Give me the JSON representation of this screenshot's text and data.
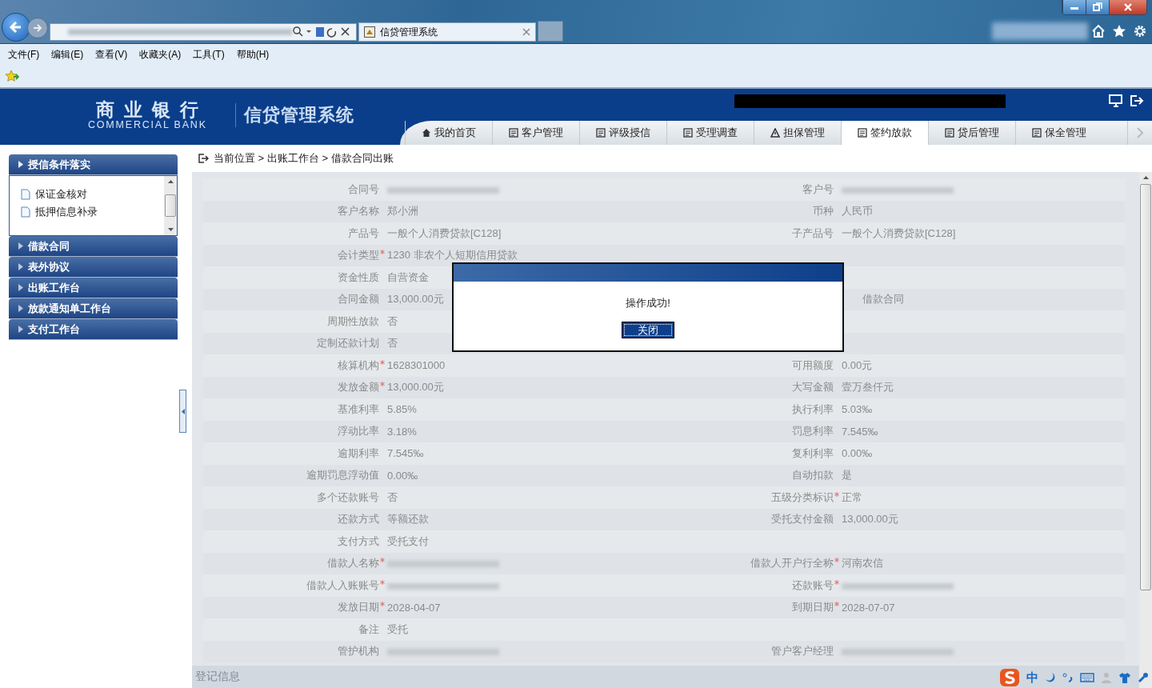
{
  "browser": {
    "tab_title": "信贷管理系统",
    "menu": [
      "文件(F)",
      "编辑(E)",
      "查看(V)",
      "收藏夹(A)",
      "工具(T)",
      "帮助(H)"
    ]
  },
  "header": {
    "logo_cn": "商业银行",
    "logo_en": "COMMERCIAL BANK",
    "system_title": "信贷管理系统",
    "tabs": [
      {
        "label": "我的首页",
        "selected": false
      },
      {
        "label": "客户管理",
        "selected": false
      },
      {
        "label": "评级授信",
        "selected": false
      },
      {
        "label": "受理调查",
        "selected": false
      },
      {
        "label": "担保管理",
        "selected": false
      },
      {
        "label": "签约放款",
        "selected": true
      },
      {
        "label": "贷后管理",
        "selected": false
      },
      {
        "label": "保全管理",
        "selected": false
      }
    ]
  },
  "sidebar": {
    "sections": [
      {
        "title": "授信条件落实",
        "expanded": true,
        "items": [
          "保证金核对",
          "抵押信息补录"
        ]
      },
      {
        "title": "借款合同",
        "expanded": false
      },
      {
        "title": "表外协议",
        "expanded": false
      },
      {
        "title": "出账工作台",
        "expanded": false
      },
      {
        "title": "放款通知单工作台",
        "expanded": false
      },
      {
        "title": "支付工作台",
        "expanded": false
      }
    ]
  },
  "breadcrumb": "当前位置 > 出账工作台 > 借款合同出账",
  "form": {
    "rows": [
      {
        "left": {
          "label": "合同号",
          "required": false,
          "redacted": true
        },
        "right": {
          "label": "客户号",
          "required": false,
          "redacted": true
        }
      },
      {
        "left": {
          "label": "客户名称",
          "required": false,
          "value": "郑小洲"
        },
        "right": {
          "label": "币种",
          "required": false,
          "value": "人民币"
        }
      },
      {
        "left": {
          "label": "产品号",
          "required": false,
          "value": "一般个人消费贷款[C128]"
        },
        "right": {
          "label": "子产品号",
          "required": false,
          "value": "一般个人消费贷款[C128]"
        }
      },
      {
        "left": {
          "label": "会计类型",
          "required": true,
          "value": "1230 非农个人短期信用贷款"
        }
      },
      {
        "left": {
          "label": "资金性质",
          "required": false,
          "value": "自营资金"
        }
      },
      {
        "left": {
          "label": "合同金额",
          "required": false,
          "value": "13,000.00元"
        },
        "right": {
          "value": "借款合同"
        }
      },
      {
        "left": {
          "label": "周期性放款",
          "required": false,
          "value": "否"
        }
      },
      {
        "left": {
          "label": "定制还款计划",
          "required": false,
          "value": "否"
        }
      },
      {
        "left": {
          "label": "核算机构",
          "required": true,
          "value": "1628301000"
        },
        "right": {
          "label": "可用额度",
          "required": false,
          "value": "0.00元"
        }
      },
      {
        "left": {
          "label": "发放金额",
          "required": true,
          "value": "13,000.00元"
        },
        "right": {
          "label": "大写金额",
          "required": false,
          "value": "壹万叁仟元"
        }
      },
      {
        "left": {
          "label": "基准利率",
          "required": false,
          "value": "5.85%"
        },
        "right": {
          "label": "执行利率",
          "required": false,
          "value": "5.03‰"
        }
      },
      {
        "left": {
          "label": "浮动比率",
          "required": false,
          "value": "3.18%"
        },
        "right": {
          "label": "罚息利率",
          "required": false,
          "value": "7.545‰"
        }
      },
      {
        "left": {
          "label": "逾期利率",
          "required": false,
          "value": "7.545‰"
        },
        "right": {
          "label": "复利利率",
          "required": false,
          "value": "0.00‰"
        }
      },
      {
        "left": {
          "label": "逾期罚息浮动值",
          "required": false,
          "value": "0.00‰"
        },
        "right": {
          "label": "自动扣款",
          "required": false,
          "value": "是"
        }
      },
      {
        "left": {
          "label": "多个还款账号",
          "required": false,
          "value": "否"
        },
        "right": {
          "label": "五级分类标识",
          "required": true,
          "value": "正常"
        }
      },
      {
        "left": {
          "label": "还款方式",
          "required": false,
          "value": "等额还款"
        },
        "right": {
          "label": "受托支付金额",
          "required": false,
          "value": "13,000.00元"
        }
      },
      {
        "left": {
          "label": "支付方式",
          "required": false,
          "value": "受托支付"
        }
      },
      {
        "left": {
          "label": "借款人名称",
          "required": true,
          "redacted": true
        },
        "right": {
          "label": "借款人开户行全称",
          "required": true,
          "value": "河南农信"
        }
      },
      {
        "left": {
          "label": "借款人入账账号",
          "required": true,
          "redacted": true
        },
        "right": {
          "label": "还款账号",
          "required": true,
          "redacted": true
        }
      },
      {
        "left": {
          "label": "发放日期",
          "required": true,
          "value": "2028-04-07"
        },
        "right": {
          "label": "到期日期",
          "required": true,
          "value": "2028-07-07"
        }
      },
      {
        "left": {
          "label": "备注",
          "required": false,
          "value": "受托"
        }
      },
      {
        "left": {
          "label": "管护机构",
          "required": false,
          "redacted": true
        },
        "right": {
          "label": "管户客户经理",
          "required": false,
          "redacted": true
        }
      }
    ],
    "next_section": "登记信息"
  },
  "dialog": {
    "message": "操作成功!",
    "button": "关闭"
  },
  "ime_bar": {
    "mode": "中"
  }
}
